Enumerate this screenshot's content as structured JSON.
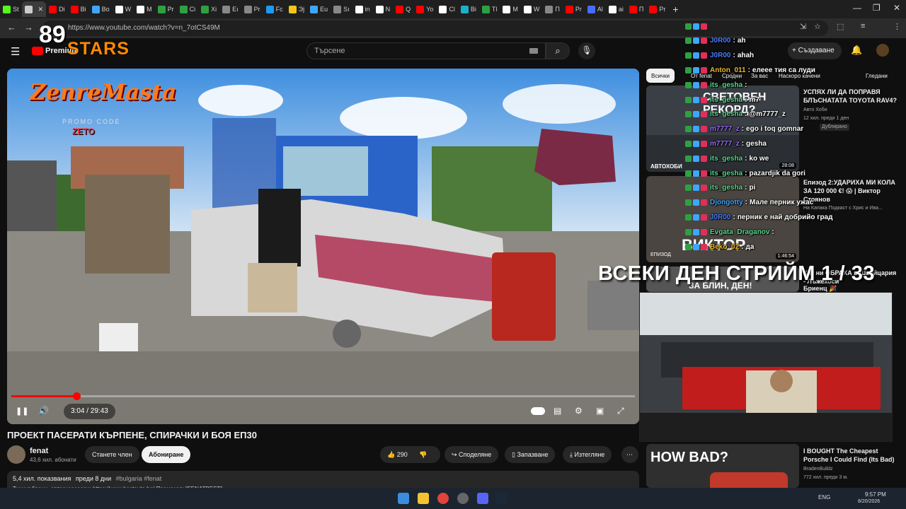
{
  "browser": {
    "tabs": [
      {
        "label": "St",
        "color": "#53fc18"
      },
      {
        "label": "",
        "color": "#cccccc",
        "active": true
      },
      {
        "label": "Di",
        "color": "#ff0000"
      },
      {
        "label": "Bi",
        "color": "#ff0000"
      },
      {
        "label": "Bo",
        "color": "#3ea6ff"
      },
      {
        "label": "W",
        "color": "#ffffff"
      },
      {
        "label": "M",
        "color": "#ffffff"
      },
      {
        "label": "Pr",
        "color": "#2ea043"
      },
      {
        "label": "Ci",
        "color": "#2ea043"
      },
      {
        "label": "Xi",
        "color": "#2ea043"
      },
      {
        "label": "Eı",
        "color": "#888888"
      },
      {
        "label": "Pr",
        "color": "#888888"
      },
      {
        "label": "Fc",
        "color": "#1d9bf0"
      },
      {
        "label": "Эj",
        "color": "#f5c518"
      },
      {
        "label": "Eu",
        "color": "#3ea6ff"
      },
      {
        "label": "Sı",
        "color": "#888888"
      },
      {
        "label": "in",
        "color": "#ffffff"
      },
      {
        "label": "N",
        "color": "#ffffff"
      },
      {
        "label": "Q",
        "color": "#ff0000"
      },
      {
        "label": "Yo",
        "color": "#ff0000"
      },
      {
        "label": "Cl",
        "color": "#ffffff"
      },
      {
        "label": "Bi",
        "color": "#1cb0c8"
      },
      {
        "label": "Tl",
        "color": "#2ea043"
      },
      {
        "label": "M",
        "color": "#ffffff"
      },
      {
        "label": "W",
        "color": "#ffffff"
      },
      {
        "label": "П",
        "color": "#888888"
      },
      {
        "label": "Pr",
        "color": "#ff0000"
      },
      {
        "label": "Al",
        "color": "#4a6cf7"
      },
      {
        "label": "ai",
        "color": "#ffffff"
      },
      {
        "label": "П",
        "color": "#ff0000"
      },
      {
        "label": "Pr",
        "color": "#ff0000"
      }
    ],
    "url": "https://www.youtube.com/watch?v=n_7otCS49M",
    "new_tab": "+",
    "back": "←",
    "forward": "→",
    "reload": "⟳",
    "min": "—",
    "max": "❐",
    "close": "✕"
  },
  "youtube": {
    "logo": "Premium",
    "search_placeholder": "Търсене",
    "search_icon": "⌕",
    "mic_icon": "🎙",
    "create_label": "+ Създаване",
    "bell_icon": "🔔",
    "menu_icon": "☰"
  },
  "overlay": {
    "brand_number": "89",
    "brand_name": "STARS",
    "sponsor": "ZenreMasta",
    "promo_label": "PROMO CODE",
    "promo_code": "ZETO"
  },
  "player": {
    "time": "3:04 / 29:43",
    "progress": 0.104,
    "play_icon": "❚❚",
    "volume_icon": "🔊"
  },
  "video": {
    "title": "ПРОЕКТ ПАСЕРАТИ КЪРПЕНЕ, СПИРАЧКИ И БОЯ ЕП30",
    "channel": "fenat",
    "subscribers": "43,6 хил. абонати",
    "join_label": "Станете член",
    "subscribe_label": "Абониране",
    "likes": "290",
    "share_label": "Споделяне",
    "save_label": "Запазване",
    "download_label": "Изтегляне",
    "more": "⋯",
    "views": "5,4 хил. показвания",
    "date": "преди 8 дни",
    "tags": "#bulgaria #fenat",
    "desc_line": "Тунинг брони, автоаксесоари: https://www.bestauto.bg/ Промокод: \"FENATBEST\""
  },
  "chips": [
    {
      "label": "Всички"
    },
    {
      "label": "От fenat"
    },
    {
      "label": "Сродни"
    },
    {
      "label": "За вас"
    },
    {
      "label": "Наскоро качени"
    },
    {
      "label": "Гледани"
    }
  ],
  "recommendations": [
    {
      "title": "УСПЯХ ЛИ ДА ПОПРАВЯ БЛЪСНАТАТА TOYOTA RAV4?",
      "channel": "Авто Хоби",
      "meta": "12 хил. преди 1 ден",
      "badge": "Дублирано",
      "duration": "28:08",
      "thumb_text": "СВЕТОВЕН РЕКОРД?",
      "thumb_label": "АВТОХОБИ"
    },
    {
      "title": "Епизод 2:УДАРИХА МИ КОЛА ЗА 120 000 €! 😱 | Виктор Стоянов",
      "channel": "На Капака Подкаст с Хрис и Ива...",
      "meta": "",
      "duration": "1:46:54",
      "thumb_text": "ВИКТОР",
      "thumb_label": "ЕПИЗОД"
    },
    {
      "title": "Как ни ОБРАХА в Швейцария - Лъжехоси",
      "title_tail": "Бриенц 🎉",
      "channel": "",
      "meta": "",
      "duration": "",
      "thumb_text": "ЗА БЛИН, ДЕН!",
      "thumb_label": ""
    },
    {
      "title": "I BOUGHT The Cheapest Porsche I Could Find (Its Bad)",
      "channel": "BradenBuildz",
      "meta": "772 хил. преди 3 м.",
      "duration": "",
      "thumb_text": "HOW BAD?",
      "thumb_label": ""
    }
  ],
  "chat": [
    {
      "user": "",
      "msg": "",
      "color": "#ffffff"
    },
    {
      "user": "J0R00",
      "msg": "ah",
      "color": "#4a7dff"
    },
    {
      "user": "J0R00",
      "msg": "ahah",
      "color": "#4a7dff"
    },
    {
      "user": "Anton_011",
      "msg": "елеее тия са луди",
      "color": "#e8b72a"
    },
    {
      "user": "its_gesha",
      "msg": "",
      "color": "#58d68d"
    },
    {
      "user": "its_gesha",
      "msg": "m7",
      "color": "#58d68d"
    },
    {
      "user": "its_gesha",
      "msg": "@m7777_z",
      "color": "#58d68d"
    },
    {
      "user": "m7777_z",
      "msg": "ego i toq gomnar",
      "color": "#9b6bff"
    },
    {
      "user": "m7777_z",
      "msg": "gesha",
      "color": "#9b6bff"
    },
    {
      "user": "its_gesha",
      "msg": "ko we",
      "color": "#58d68d"
    },
    {
      "user": "its_gesha",
      "msg": "pazardjik da gori",
      "color": "#58d68d"
    },
    {
      "user": "its_gesha",
      "msg": "pi",
      "color": "#58d68d"
    },
    {
      "user": "Djongotty",
      "msg": "Мале перник ужас",
      "color": "#3ea6ff"
    },
    {
      "user": "J0R00",
      "msg": "перник е най добрийо град",
      "color": "#4a7dff"
    },
    {
      "user": "Evgata_Draganov",
      "msg": "",
      "color": "#58d68d"
    },
    {
      "user": "Beko_02",
      "msg": "да",
      "color": "#e8b72a"
    }
  ],
  "stream_banner": "ВСЕКИ ДЕН СТРИЙМ 1 / 33",
  "taskbar": {
    "lang": "ENG",
    "time": "9:57 PM",
    "date": "8/20/2026"
  }
}
